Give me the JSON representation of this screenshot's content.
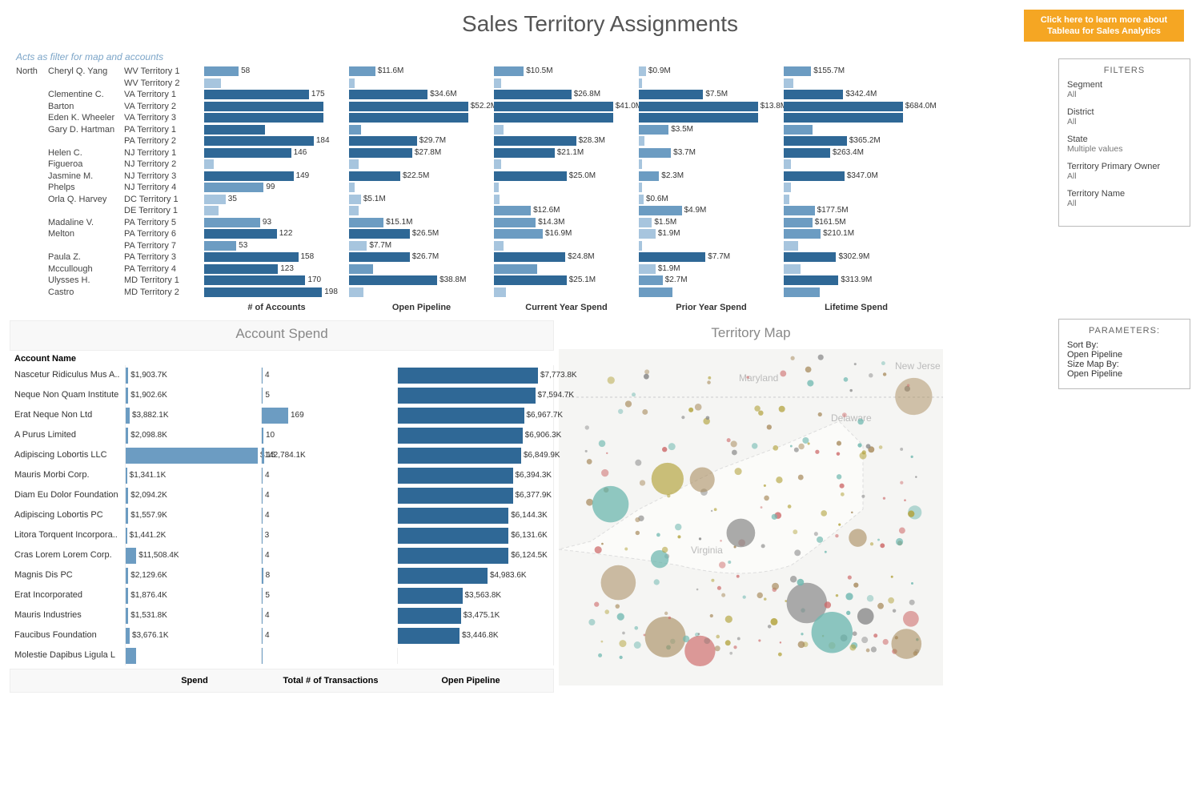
{
  "header": {
    "title": "Sales Territory Assignments",
    "cta": "Click here to learn more about Tableau for Sales Analytics"
  },
  "hint": "Acts as filter for map and accounts",
  "filters": {
    "title": "FILTERS",
    "segment_label": "Segment",
    "segment_value": "All",
    "district_label": "District",
    "district_value": "All",
    "state_label": "State",
    "state_value": "Multiple values",
    "owner_label": "Territory Primary Owner",
    "owner_value": "All",
    "tname_label": "Territory Name",
    "tname_value": "All"
  },
  "parameters": {
    "title": "PARAMETERS:",
    "sortby_label": "Sort By:",
    "sortby_value": "Open Pipeline",
    "sizemap_label": "Size Map By:",
    "sizemap_value": "Open Pipeline"
  },
  "col_headers": {
    "acc": "# of Accounts",
    "op": "Open Pipeline",
    "cy": "Current Year Spend",
    "py": "Prior Year Spend",
    "lt": "Lifetime Spend"
  },
  "territory_rows": [
    {
      "region": "North",
      "owner": "Cheryl Q. Yang",
      "terr": "WV Territory 1",
      "acc": 58,
      "accW": 29,
      "accC": "color-mid",
      "op": "$11.6M",
      "opW": 22,
      "opC": "color-mid",
      "cy": "$10.5M",
      "cyW": 25,
      "cyC": "color-mid",
      "py": "$0.9M",
      "pyW": 6,
      "pyC": "color-light",
      "lt": "$155.7M",
      "ltW": 23,
      "ltC": "color-mid"
    },
    {
      "region": "",
      "owner": "",
      "terr": "WV Territory 2",
      "acc": "",
      "accW": 14,
      "accC": "color-light",
      "op": "",
      "opW": 5,
      "opC": "color-light",
      "cy": "",
      "cyW": 6,
      "cyC": "color-light",
      "py": "",
      "pyW": 3,
      "pyC": "color-light",
      "lt": "",
      "ltW": 8,
      "ltC": "color-light"
    },
    {
      "region": "",
      "owner": "Clementine C.",
      "terr": "VA Territory 1",
      "acc": 175,
      "accW": 88,
      "accC": "color-full",
      "op": "$34.6M",
      "opW": 66,
      "opC": "color-full",
      "cy": "$26.8M",
      "cyW": 65,
      "cyC": "color-full",
      "py": "$7.5M",
      "pyW": 54,
      "pyC": "color-full",
      "lt": "$342.4M",
      "ltW": 50,
      "ltC": "color-full"
    },
    {
      "region": "",
      "owner": "Barton",
      "terr": "VA Territory 2",
      "acc": "",
      "accW": 100,
      "accC": "color-full",
      "op": "$52.2M",
      "opW": 100,
      "opC": "color-full",
      "cy": "$41.0M",
      "cyW": 100,
      "cyC": "color-full",
      "py": "$13.8M",
      "pyW": 100,
      "pyC": "color-full",
      "lt": "$684.0M",
      "ltW": 100,
      "ltC": "color-full"
    },
    {
      "region": "",
      "owner": "Eden K. Wheeler",
      "terr": "VA Territory 3",
      "acc": "",
      "accW": 100,
      "accC": "color-full",
      "op": "",
      "opW": 100,
      "opC": "color-full",
      "cy": "",
      "cyW": 100,
      "cyC": "color-full",
      "py": "",
      "pyW": 100,
      "pyC": "color-full",
      "lt": "",
      "ltW": 100,
      "ltC": "color-full"
    },
    {
      "region": "",
      "owner": "Gary D. Hartman",
      "terr": "PA Territory 1",
      "acc": "",
      "accW": 51,
      "accC": "color-full",
      "op": "",
      "opW": 10,
      "opC": "color-mid",
      "cy": "",
      "cyW": 8,
      "cyC": "color-light",
      "py": "$3.5M",
      "pyW": 25,
      "pyC": "color-mid",
      "lt": "",
      "ltW": 24,
      "ltC": "color-mid"
    },
    {
      "region": "",
      "owner": "",
      "terr": "PA Territory 2",
      "acc": 184,
      "accW": 92,
      "accC": "color-full",
      "op": "$29.7M",
      "opW": 57,
      "opC": "color-full",
      "cy": "$28.3M",
      "cyW": 69,
      "cyC": "color-full",
      "py": "",
      "pyW": 5,
      "pyC": "color-light",
      "lt": "$365.2M",
      "ltW": 53,
      "ltC": "color-full"
    },
    {
      "region": "",
      "owner": "Helen C.",
      "terr": "NJ Territory 1",
      "acc": 146,
      "accW": 73,
      "accC": "color-full",
      "op": "$27.8M",
      "opW": 53,
      "opC": "color-full",
      "cy": "$21.1M",
      "cyW": 51,
      "cyC": "color-full",
      "py": "$3.7M",
      "pyW": 27,
      "pyC": "color-mid",
      "lt": "$263.4M",
      "ltW": 39,
      "ltC": "color-full"
    },
    {
      "region": "",
      "owner": "Figueroa",
      "terr": "NJ Territory 2",
      "acc": "",
      "accW": 8,
      "accC": "color-light",
      "op": "",
      "opW": 8,
      "opC": "color-light",
      "cy": "",
      "cyW": 6,
      "cyC": "color-light",
      "py": "",
      "pyW": 3,
      "pyC": "color-light",
      "lt": "",
      "ltW": 6,
      "ltC": "color-light"
    },
    {
      "region": "",
      "owner": "Jasmine M.",
      "terr": "NJ Territory 3",
      "acc": 149,
      "accW": 75,
      "accC": "color-full",
      "op": "$22.5M",
      "opW": 43,
      "opC": "color-full",
      "cy": "$25.0M",
      "cyW": 61,
      "cyC": "color-full",
      "py": "$2.3M",
      "pyW": 17,
      "pyC": "color-mid",
      "lt": "$347.0M",
      "ltW": 51,
      "ltC": "color-full"
    },
    {
      "region": "",
      "owner": "Phelps",
      "terr": "NJ Territory 4",
      "acc": 99,
      "accW": 50,
      "accC": "color-mid",
      "op": "",
      "opW": 5,
      "opC": "color-light",
      "cy": "",
      "cyW": 4,
      "cyC": "color-light",
      "py": "",
      "pyW": 3,
      "pyC": "color-light",
      "lt": "",
      "ltW": 6,
      "ltC": "color-light"
    },
    {
      "region": "",
      "owner": "Orla Q. Harvey",
      "terr": "DC Territory 1",
      "acc": 35,
      "accW": 18,
      "accC": "color-light",
      "op": "$5.1M",
      "opW": 10,
      "opC": "color-light",
      "cy": "",
      "cyW": 5,
      "cyC": "color-light",
      "py": "$0.6M",
      "pyW": 4,
      "pyC": "color-light",
      "lt": "",
      "ltW": 5,
      "ltC": "color-light"
    },
    {
      "region": "",
      "owner": "",
      "terr": "DE Territory 1",
      "acc": "",
      "accW": 12,
      "accC": "color-light",
      "op": "",
      "opW": 8,
      "opC": "color-light",
      "cy": "$12.6M",
      "cyW": 31,
      "cyC": "color-mid",
      "py": "$4.9M",
      "pyW": 36,
      "pyC": "color-mid",
      "lt": "$177.5M",
      "ltW": 26,
      "ltC": "color-mid"
    },
    {
      "region": "",
      "owner": "Madaline V.",
      "terr": "PA Territory 5",
      "acc": 93,
      "accW": 47,
      "accC": "color-mid",
      "op": "$15.1M",
      "opW": 29,
      "opC": "color-mid",
      "cy": "$14.3M",
      "cyW": 35,
      "cyC": "color-mid",
      "py": "$1.5M",
      "pyW": 11,
      "pyC": "color-light",
      "lt": "$161.5M",
      "ltW": 24,
      "ltC": "color-mid"
    },
    {
      "region": "",
      "owner": "Melton",
      "terr": "PA Territory 6",
      "acc": 122,
      "accW": 61,
      "accC": "color-full",
      "op": "$26.5M",
      "opW": 51,
      "opC": "color-full",
      "cy": "$16.9M",
      "cyW": 41,
      "cyC": "color-mid",
      "py": "$1.9M",
      "pyW": 14,
      "pyC": "color-light",
      "lt": "$210.1M",
      "ltW": 31,
      "ltC": "color-mid"
    },
    {
      "region": "",
      "owner": "",
      "terr": "PA Territory 7",
      "acc": 53,
      "accW": 27,
      "accC": "color-mid",
      "op": "$7.7M",
      "opW": 15,
      "opC": "color-light",
      "cy": "",
      "cyW": 8,
      "cyC": "color-light",
      "py": "",
      "pyW": 3,
      "pyC": "color-light",
      "lt": "",
      "ltW": 12,
      "ltC": "color-light"
    },
    {
      "region": "",
      "owner": "Paula Z.",
      "terr": "PA Territory 3",
      "acc": 158,
      "accW": 79,
      "accC": "color-full",
      "op": "$26.7M",
      "opW": 51,
      "opC": "color-full",
      "cy": "$24.8M",
      "cyW": 60,
      "cyC": "color-full",
      "py": "$7.7M",
      "pyW": 56,
      "pyC": "color-full",
      "lt": "$302.9M",
      "ltW": 44,
      "ltC": "color-full"
    },
    {
      "region": "",
      "owner": "Mccullough",
      "terr": "PA Territory 4",
      "acc": 123,
      "accW": 62,
      "accC": "color-full",
      "op": "",
      "opW": 20,
      "opC": "color-mid",
      "cy": "",
      "cyW": 36,
      "cyC": "color-mid",
      "py": "$1.9M",
      "pyW": 14,
      "pyC": "color-light",
      "lt": "",
      "ltW": 14,
      "ltC": "color-light"
    },
    {
      "region": "",
      "owner": "Ulysses H.",
      "terr": "MD Territory 1",
      "acc": 170,
      "accW": 85,
      "accC": "color-full",
      "op": "$38.8M",
      "opW": 74,
      "opC": "color-full",
      "cy": "$25.1M",
      "cyW": 61,
      "cyC": "color-full",
      "py": "$2.7M",
      "pyW": 20,
      "pyC": "color-mid",
      "lt": "$313.9M",
      "ltW": 46,
      "ltC": "color-full"
    },
    {
      "region": "",
      "owner": "Castro",
      "terr": "MD Territory 2",
      "acc": 198,
      "accW": 99,
      "accC": "color-full",
      "op": "",
      "opW": 12,
      "opC": "color-light",
      "cy": "",
      "cyW": 10,
      "cyC": "color-light",
      "py": "",
      "pyW": 28,
      "pyC": "color-mid",
      "lt": "",
      "ltW": 30,
      "ltC": "color-mid"
    }
  ],
  "account_spend": {
    "title": "Account Spend",
    "name_header": "Account Name",
    "cols": {
      "spend": "Spend",
      "trans": "Total # of Transactions",
      "pipe": "Open Pipeline"
    },
    "rows": [
      {
        "name": "Nascetur Ridiculus Mus A..",
        "spend": "$1,903.7K",
        "spendW": 2,
        "trans": "4",
        "transW": 3,
        "pipe": "$7,773.8K",
        "pipeW": 100
      },
      {
        "name": "Neque Non Quam Institute",
        "spend": "$1,902.6K",
        "spendW": 2,
        "trans": "5",
        "transW": 4,
        "pipe": "$7,594.7K",
        "pipeW": 98
      },
      {
        "name": "Erat Neque Non Ltd",
        "spend": "$3,882.1K",
        "spendW": 3,
        "trans": "169",
        "transW": 100,
        "pipe": "$6,967.7K",
        "pipeW": 90
      },
      {
        "name": "A Purus Limited",
        "spend": "$2,098.8K",
        "spendW": 2,
        "trans": "10",
        "transW": 6,
        "pipe": "$6,906.3K",
        "pipeW": 89
      },
      {
        "name": "Adipiscing Lobortis LLC",
        "spend": "$142,784.1K",
        "spendW": 100,
        "trans": "15",
        "transW": 9,
        "pipe": "$6,849.9K",
        "pipeW": 88
      },
      {
        "name": "Mauris Morbi Corp.",
        "spend": "$1,341.1K",
        "spendW": 1,
        "trans": "4",
        "transW": 3,
        "pipe": "$6,394.3K",
        "pipeW": 82
      },
      {
        "name": "Diam Eu Dolor Foundation",
        "spend": "$2,094.2K",
        "spendW": 2,
        "trans": "4",
        "transW": 3,
        "pipe": "$6,377.9K",
        "pipeW": 82
      },
      {
        "name": "Adipiscing Lobortis PC",
        "spend": "$1,557.9K",
        "spendW": 2,
        "trans": "4",
        "transW": 3,
        "pipe": "$6,144.3K",
        "pipeW": 79
      },
      {
        "name": "Litora Torquent Incorpora..",
        "spend": "$1,441.2K",
        "spendW": 1,
        "trans": "3",
        "transW": 2,
        "pipe": "$6,131.6K",
        "pipeW": 79
      },
      {
        "name": "Cras Lorem Lorem Corp.",
        "spend": "$11,508.4K",
        "spendW": 8,
        "trans": "4",
        "transW": 3,
        "pipe": "$6,124.5K",
        "pipeW": 79
      },
      {
        "name": "Magnis Dis PC",
        "spend": "$2,129.6K",
        "spendW": 2,
        "trans": "8",
        "transW": 5,
        "pipe": "$4,983.6K",
        "pipeW": 64
      },
      {
        "name": "Erat Incorporated",
        "spend": "$1,876.4K",
        "spendW": 2,
        "trans": "5",
        "transW": 4,
        "pipe": "$3,563.8K",
        "pipeW": 46
      },
      {
        "name": "Mauris Industries",
        "spend": "$1,531.8K",
        "spendW": 2,
        "trans": "4",
        "transW": 3,
        "pipe": "$3,475.1K",
        "pipeW": 45
      },
      {
        "name": "Faucibus Foundation",
        "spend": "$3,676.1K",
        "spendW": 3,
        "trans": "4",
        "transW": 3,
        "pipe": "$3,446.8K",
        "pipeW": 44
      },
      {
        "name": "Molestie Dapibus Ligula L",
        "spend": "",
        "spendW": 8,
        "trans": "",
        "transW": 3,
        "pipe": "",
        "pipeW": 0
      }
    ]
  },
  "territory_map": {
    "title": "Territory Map",
    "labels": {
      "va": "Virginia",
      "md": "Maryland",
      "de": "Delaware",
      "nj": "New Jerse"
    }
  }
}
